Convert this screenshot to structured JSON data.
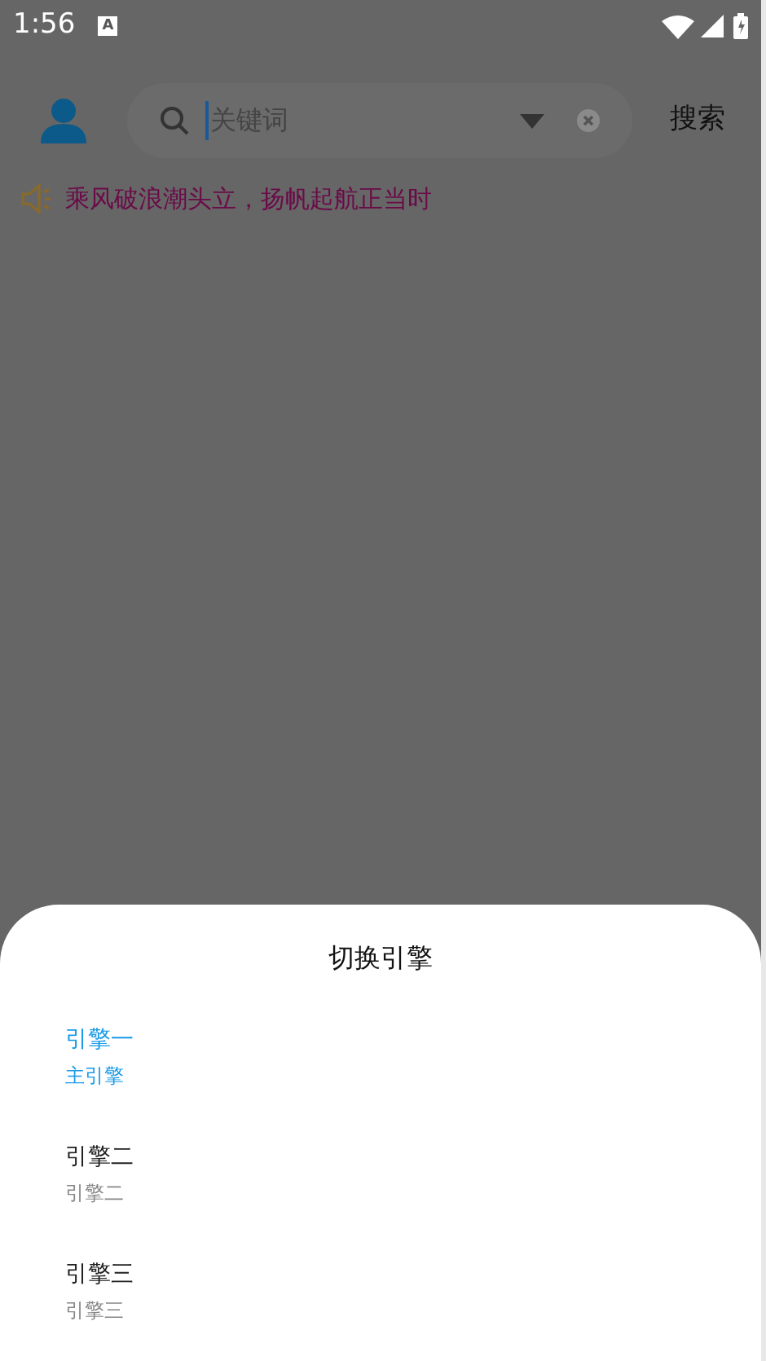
{
  "status_bar": {
    "time": "1:56",
    "notification": "A"
  },
  "header": {
    "search": {
      "placeholder": "关键词"
    },
    "search_button": "搜索"
  },
  "notice": "乘风破浪潮头立，扬帆起航正当时",
  "sheet": {
    "title": "切换引擎",
    "items": [
      {
        "label": "引擎一",
        "subtitle": "主引擎",
        "selected": true
      },
      {
        "label": "引擎二",
        "subtitle": "引擎二",
        "selected": false
      },
      {
        "label": "引擎三",
        "subtitle": "引擎三",
        "selected": false
      }
    ]
  }
}
